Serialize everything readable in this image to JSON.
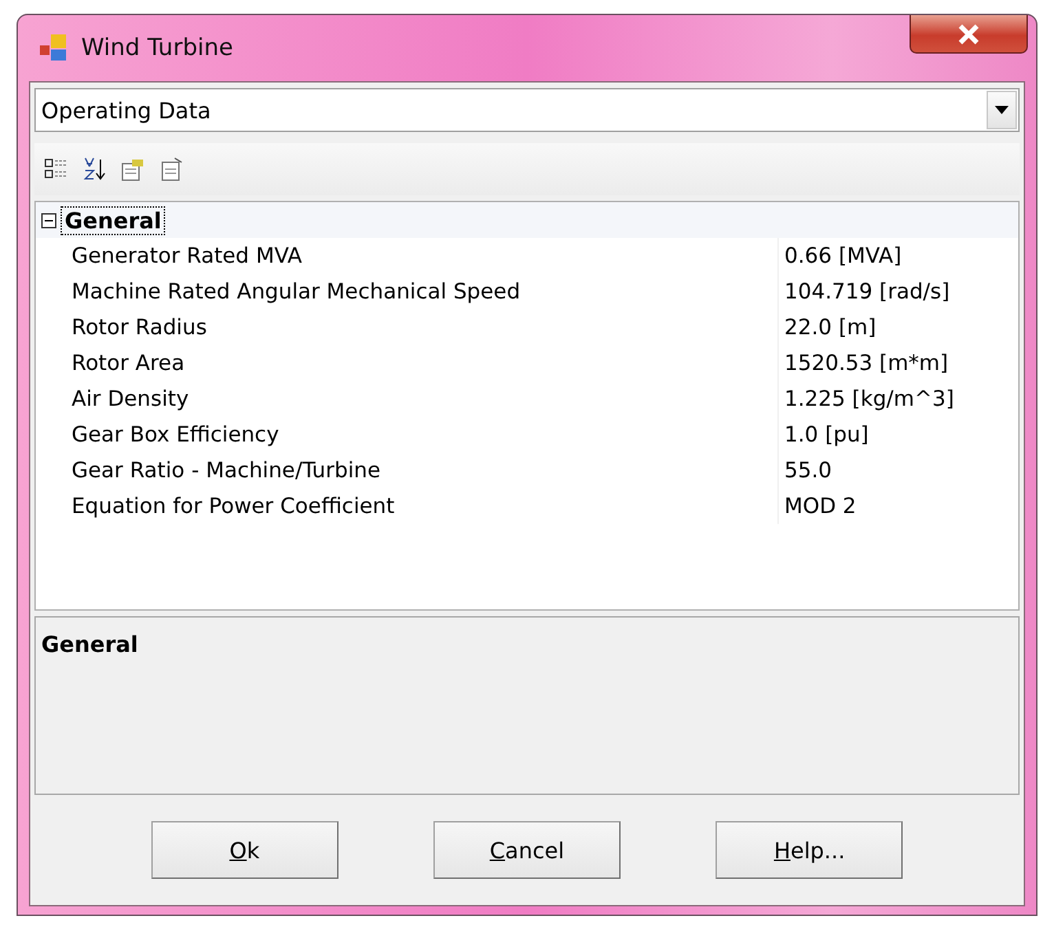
{
  "window": {
    "title": "Wind Turbine"
  },
  "category_dropdown": {
    "value": "Operating Data"
  },
  "grid": {
    "category": {
      "name": "General",
      "expanded": true,
      "selected": true
    },
    "rows": [
      {
        "name": "Generator Rated MVA",
        "value": "0.66 [MVA]"
      },
      {
        "name": "Machine Rated Angular Mechanical Speed",
        "value": "104.719 [rad/s]"
      },
      {
        "name": "Rotor Radius",
        "value": "22.0 [m]"
      },
      {
        "name": "Rotor Area",
        "value": "1520.53 [m*m]"
      },
      {
        "name": "Air Density",
        "value": "1.225 [kg/m^3]"
      },
      {
        "name": "Gear Box Efficiency",
        "value": "1.0 [pu]"
      },
      {
        "name": "Gear Ratio - Machine/Turbine",
        "value": "55.0"
      },
      {
        "name": "Equation for Power Coefficient",
        "value": "MOD 2"
      }
    ]
  },
  "description": {
    "title": "General"
  },
  "buttons": [
    {
      "label": "Ok",
      "mnemonic": true
    },
    {
      "label": "Cancel",
      "mnemonic": true
    },
    {
      "label": "Help...",
      "mnemonic": true
    }
  ]
}
